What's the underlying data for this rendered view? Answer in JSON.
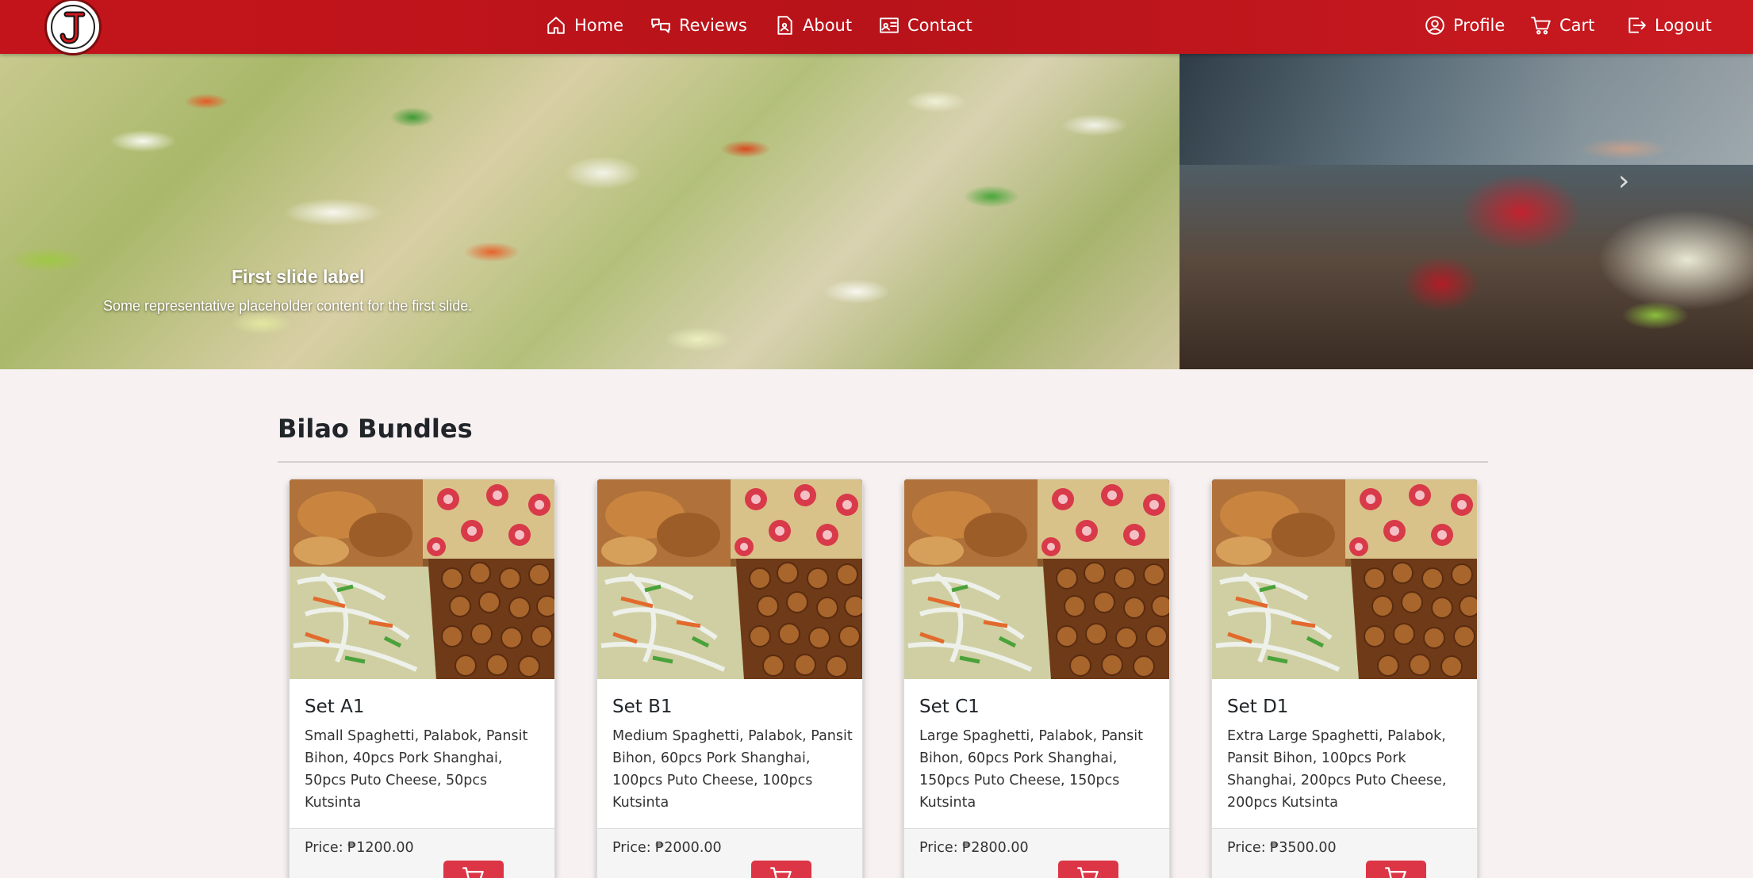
{
  "nav": {
    "links": [
      {
        "label": "Home",
        "icon": "home-icon"
      },
      {
        "label": "Reviews",
        "icon": "reviews-icon"
      },
      {
        "label": "About",
        "icon": "about-icon"
      },
      {
        "label": "Contact",
        "icon": "contact-icon"
      }
    ],
    "right": [
      {
        "label": "Profile",
        "icon": "profile-icon"
      },
      {
        "label": "Cart",
        "icon": "cart-icon"
      },
      {
        "label": "Logout",
        "icon": "logout-icon"
      }
    ],
    "logo_letter": "J"
  },
  "carousel": {
    "caption_title": "First slide label",
    "caption_text": "Some representative placeholder content for the first slide.",
    "next_glyph": "›"
  },
  "section": {
    "title": "Bilao Bundles"
  },
  "cards": [
    {
      "title": "Set A1",
      "description": "Small Spaghetti, Palabok, Pansit Bihon, 40pcs Pork Shanghai, 50pcs Puto Cheese, 50pcs Kutsinta",
      "price": "Price: ₱1200.00"
    },
    {
      "title": "Set B1",
      "description": "Medium Spaghetti, Palabok, Pansit Bihon, 60pcs Pork Shanghai, 100pcs Puto Cheese, 100pcs Kutsinta",
      "price": "Price: ₱2000.00"
    },
    {
      "title": "Set C1",
      "description": "Large Spaghetti, Palabok, Pansit Bihon, 60pcs Pork Shanghai, 150pcs Puto Cheese, 150pcs Kutsinta",
      "price": "Price: ₱2800.00"
    },
    {
      "title": "Set D1",
      "description": "Extra Large Spaghetti, Palabok, Pansit Bihon, 100pcs Pork Shanghai, 200pcs Puto Cheese, 200pcs Kutsinta",
      "price": "Price: ₱3500.00"
    }
  ],
  "colors": {
    "navbar": "#c4141b",
    "button": "#dc3545",
    "page_bg": "#f7f1f1"
  }
}
